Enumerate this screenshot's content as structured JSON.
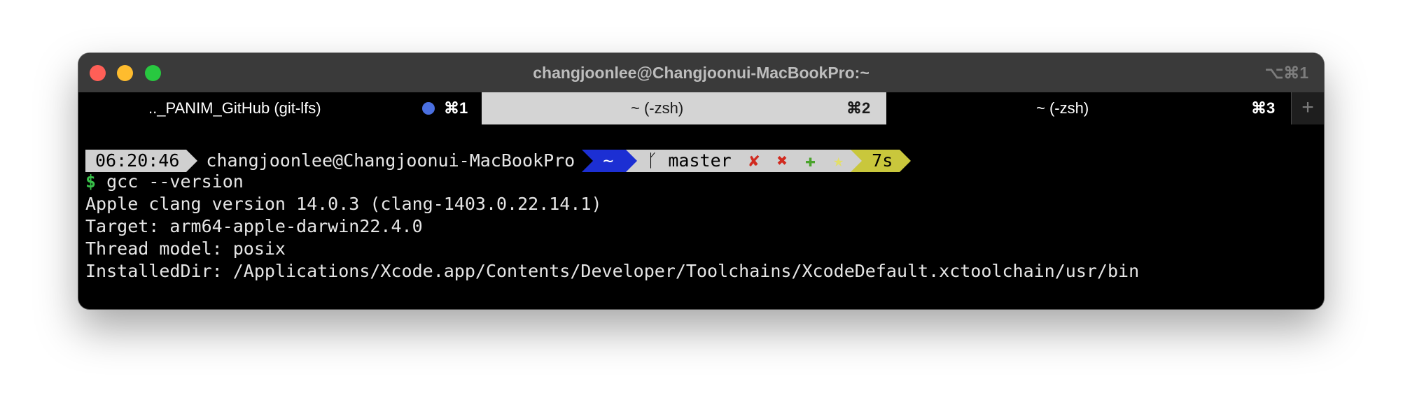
{
  "window": {
    "title": "changjoonlee@Changjoonui-MacBookPro:~",
    "shortcut": "⌥⌘1"
  },
  "tabs": [
    {
      "title": ".._PANIM_GitHub (git-lfs)",
      "shortcut": "⌘1",
      "has_dot": true,
      "dot_color": "#4a6fe0",
      "active": false
    },
    {
      "title": "~ (-zsh)",
      "shortcut": "⌘2",
      "active": true
    },
    {
      "title": "~ (-zsh)",
      "shortcut": "⌘3",
      "active": false
    }
  ],
  "tab_add_label": "+",
  "prompt": {
    "time": "06:20:46",
    "host": "changjoonlee@Changjoonui-MacBookPro",
    "directory": "~",
    "git_icon": "git-branch-icon",
    "git_branch_glyph": "ᚴ",
    "git_branch": "master",
    "git_status": [
      {
        "symbol": "✘",
        "color": "#d12a1f"
      },
      {
        "symbol": "✖",
        "color": "#d12a1f"
      },
      {
        "symbol": "✚",
        "color": "#4aa32b"
      },
      {
        "symbol": "★",
        "color": "#e3df6a"
      }
    ],
    "duration": "7s",
    "colors": {
      "time_bg": "#d0d0d0",
      "dir_bg": "#1c2fd3",
      "git_bg": "#d0d0d0",
      "duration_bg": "#c9c73c"
    }
  },
  "command": {
    "symbol": "$",
    "text": "gcc --version"
  },
  "output": [
    "Apple clang version 14.0.3 (clang-1403.0.22.14.1)",
    "Target: arm64-apple-darwin22.4.0",
    "Thread model: posix",
    "InstalledDir: /Applications/Xcode.app/Contents/Developer/Toolchains/XcodeDefault.xctoolchain/usr/bin"
  ]
}
